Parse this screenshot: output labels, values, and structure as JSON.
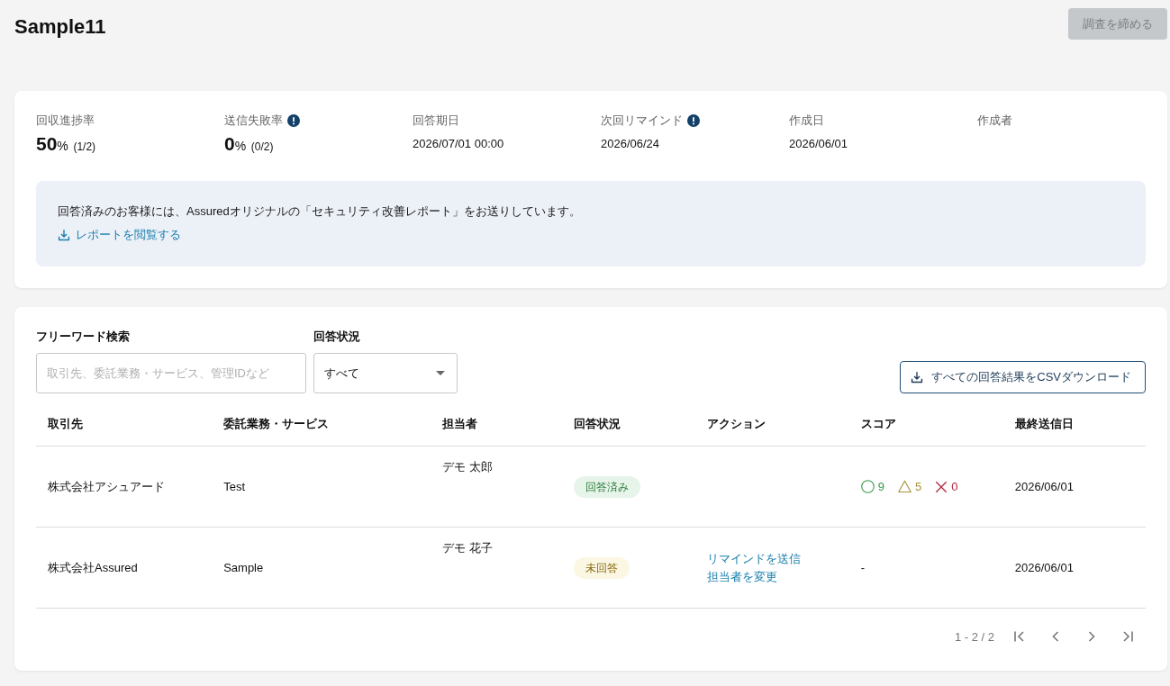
{
  "header": {
    "title": "Sample11",
    "close_button": {
      "label": "調査を締める",
      "disabled": true
    }
  },
  "summary": {
    "stats": [
      {
        "kind": "rate",
        "label": "回収進捗率",
        "info": false,
        "number": "50",
        "unit": "%",
        "detail": "(1/2)"
      },
      {
        "kind": "rate",
        "label": "送信失敗率",
        "info": true,
        "number": "0",
        "unit": "%",
        "detail": "(0/2)"
      },
      {
        "kind": "text",
        "label": "回答期日",
        "info": false,
        "value": "2026/07/01 00:00"
      },
      {
        "kind": "text",
        "label": "次回リマインド",
        "info": true,
        "value": "2026/06/24"
      },
      {
        "kind": "text",
        "label": "作成日",
        "info": false,
        "value": "2026/06/01"
      },
      {
        "kind": "text",
        "label": "作成者",
        "info": false
      }
    ],
    "notice": {
      "message": "回答済みのお客様には、Assuredオリジナルの「セキュリティ改善レポート」をお送りしています。",
      "link": "レポートを閲覧する"
    }
  },
  "filters": {
    "search": {
      "label": "フリーワード検索",
      "placeholder": "取引先、委託業務・サービス、管理IDなど"
    },
    "status": {
      "label": "回答状況",
      "value": "すべて"
    },
    "download_button": "すべての回答結果をCSVダウンロード"
  },
  "table": {
    "columns": [
      "取引先",
      "委託業務・サービス",
      "担当者",
      "回答状況",
      "アクション",
      "スコア",
      "最終送信日"
    ],
    "rows": [
      {
        "company": "株式会社アシュアード",
        "service": "Test",
        "assignee": "デモ 太郎",
        "status": {
          "label": "回答済み",
          "kind": "answered"
        },
        "score": {
          "kind": "counts",
          "items": [
            {
              "kind": "good",
              "count": "9"
            },
            {
              "kind": "fair",
              "count": "5"
            },
            {
              "kind": "poor",
              "count": "0"
            }
          ]
        },
        "last_sent": "2026/06/01"
      },
      {
        "company": "株式会社Assured",
        "service": "Sample",
        "assignee": "デモ 花子",
        "status": {
          "label": "未回答",
          "kind": "unanswered"
        },
        "actions": [
          "リマインドを送信",
          "担当者を変更"
        ],
        "score": {
          "kind": "text",
          "text": "-"
        },
        "last_sent": "2026/06/01"
      }
    ]
  },
  "pagination": {
    "range": "1 - 2 / 2"
  }
}
